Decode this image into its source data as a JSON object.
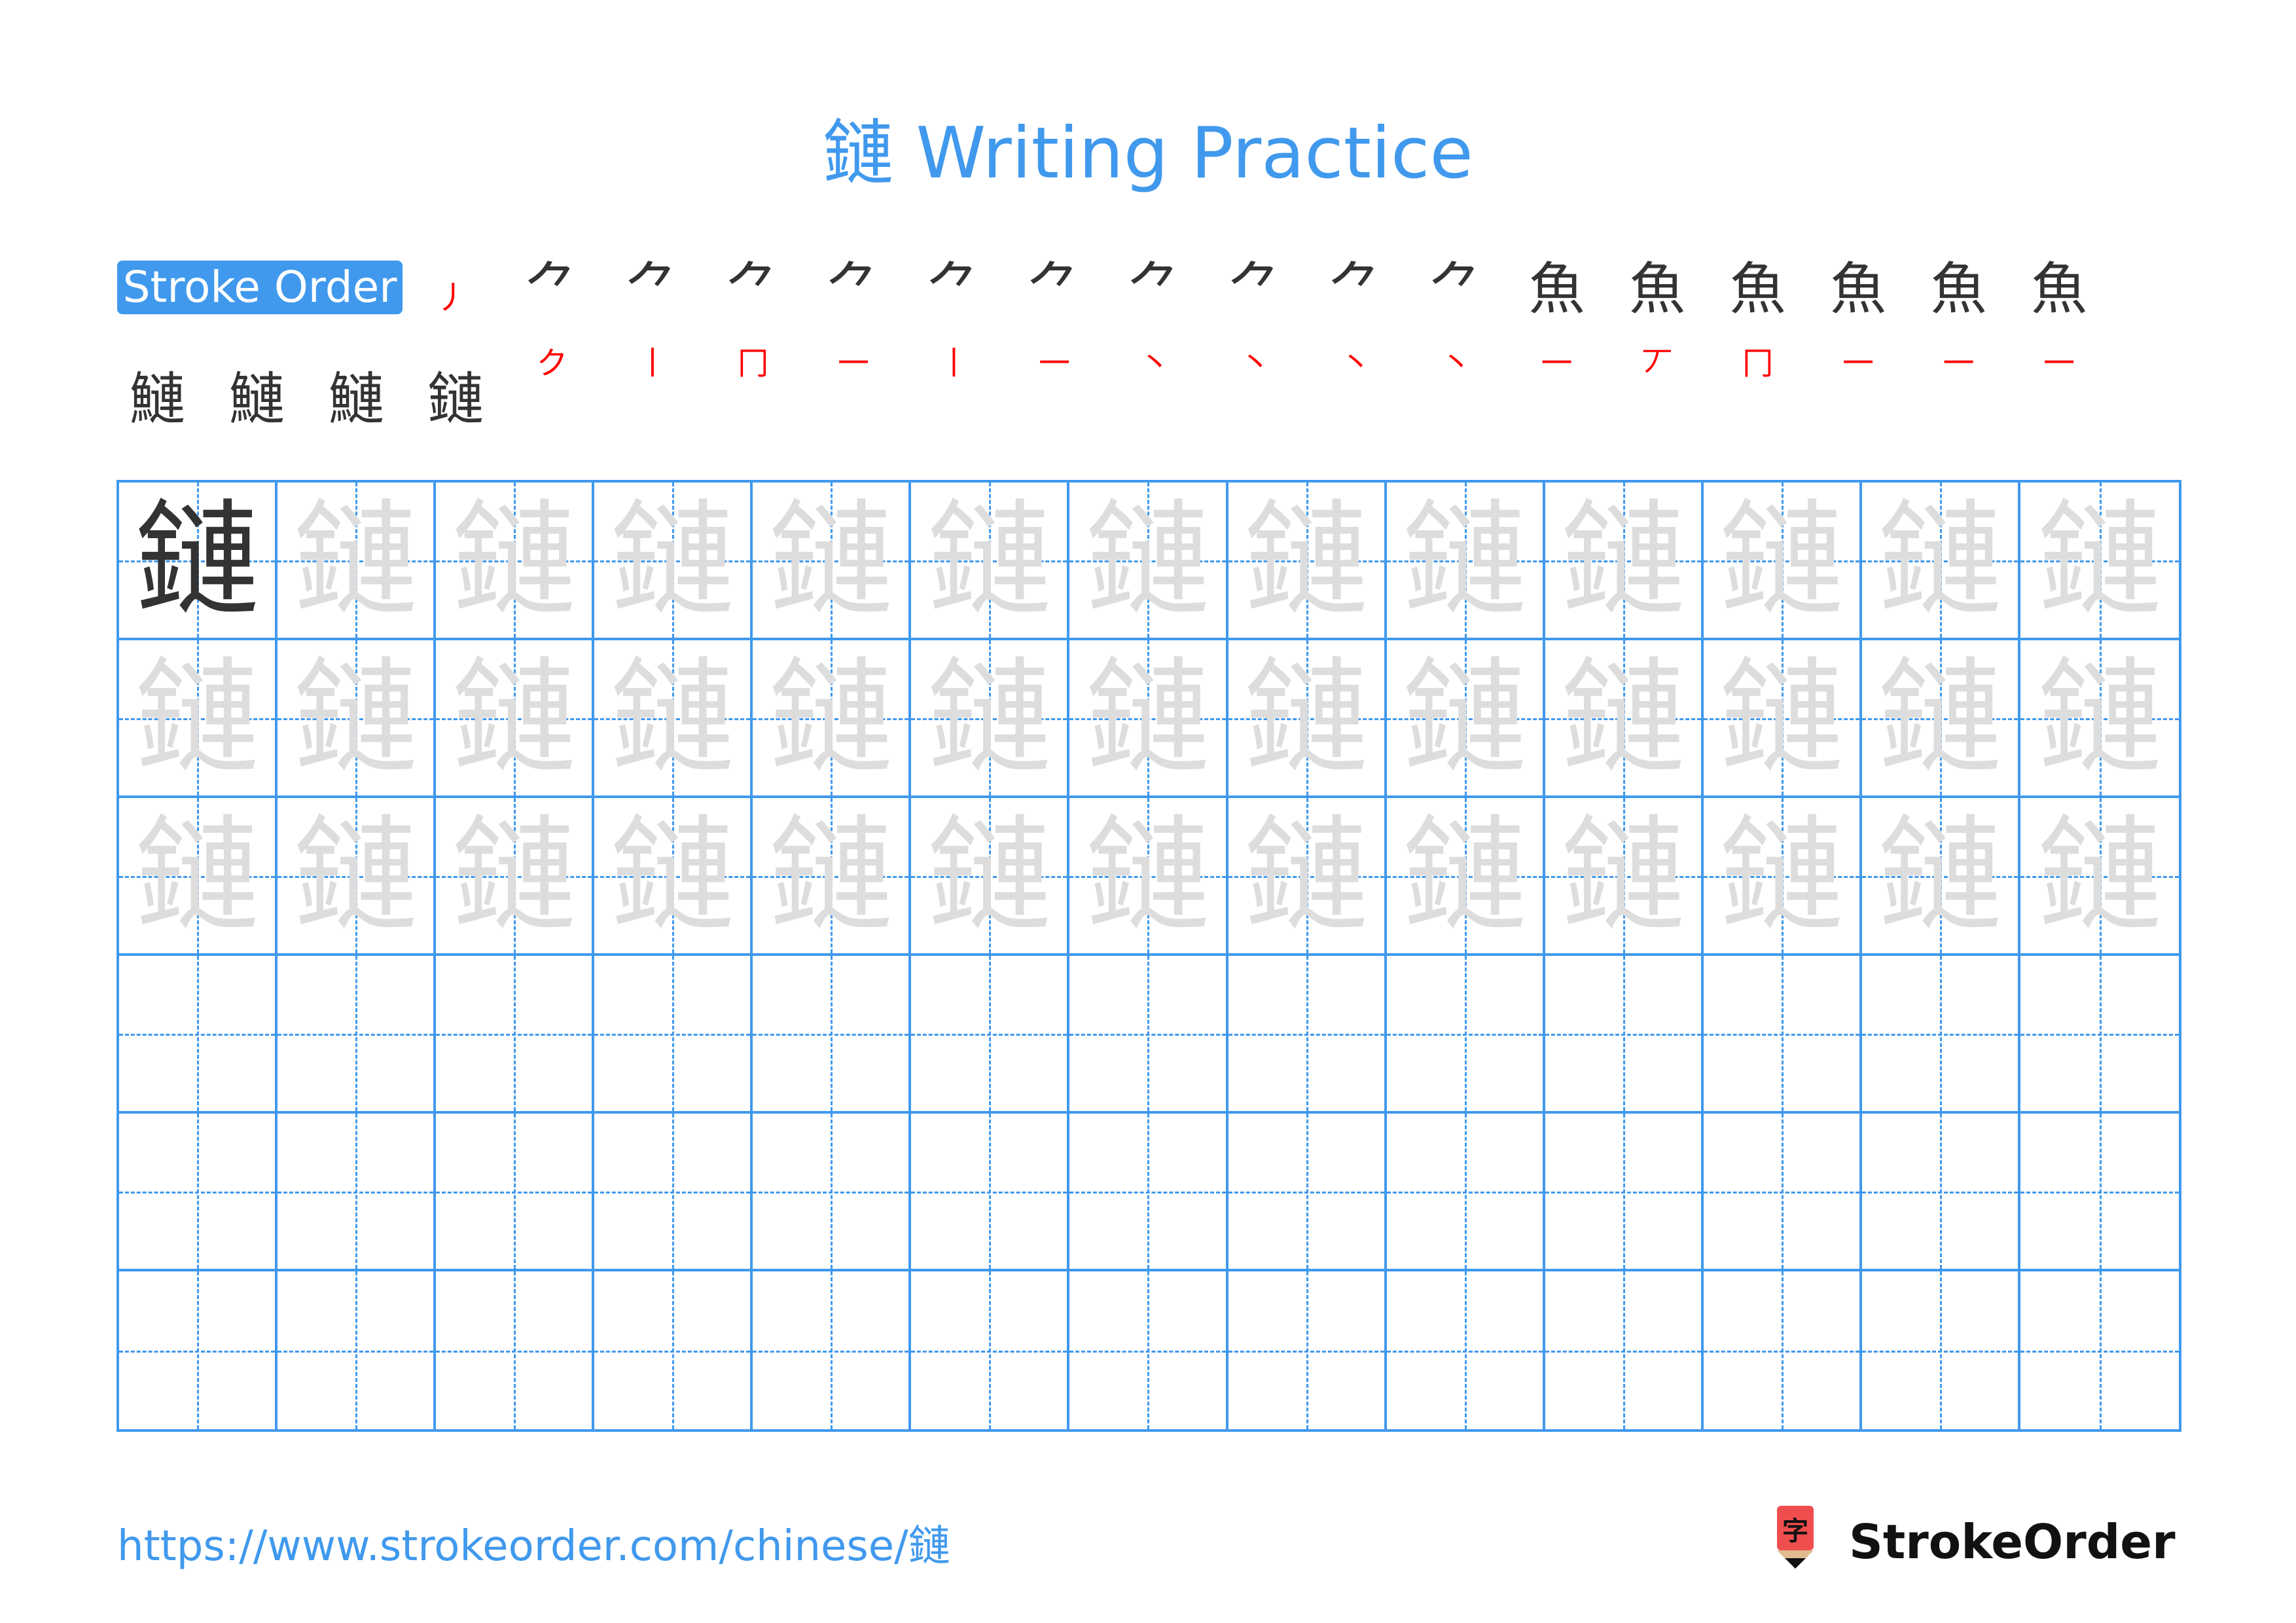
{
  "header": {
    "title": "鏈 Writing Practice"
  },
  "stroke_order": {
    "label": "Stroke Order",
    "character": "鏈",
    "total_strokes": 21,
    "steps": [
      {
        "step": 1,
        "drawn": "",
        "new": "丿"
      },
      {
        "step": 2,
        "drawn": "丿",
        "new": "𠃌"
      },
      {
        "step": 3,
        "drawn": "⺈",
        "new": "丨"
      },
      {
        "step": 4,
        "drawn": "⺈丨",
        "new": "𠃌"
      },
      {
        "step": 5,
        "drawn": "⺈冂",
        "new": "一"
      },
      {
        "step": 6,
        "drawn": "⺈冂一",
        "new": "丨"
      },
      {
        "step": 7,
        "drawn": "⺈田",
        "new": "一"
      },
      {
        "step": 8,
        "drawn": "⺈田一",
        "new": "丶"
      },
      {
        "step": 9,
        "drawn": "⺈田一丶",
        "new": "丶"
      },
      {
        "step": 10,
        "drawn": "魚(partial)",
        "new": "丶"
      },
      {
        "step": 11,
        "drawn": "魚(partial)",
        "new": "丶"
      },
      {
        "step": 12,
        "drawn": "魚",
        "new": "一"
      },
      {
        "step": 13,
        "drawn": "魚一",
        "new": "丨"
      },
      {
        "step": 14,
        "drawn": "魚丆",
        "new": "𠃍"
      },
      {
        "step": 15,
        "drawn": "魚冂",
        "new": "一"
      },
      {
        "step": 16,
        "drawn": "魚冂一",
        "new": "一"
      },
      {
        "step": 17,
        "drawn": "魚亘",
        "new": "一"
      },
      {
        "step": 18,
        "drawn": "魚亘",
        "new": "丨"
      },
      {
        "step": 19,
        "drawn": "魚車",
        "new": "丶"
      },
      {
        "step": 20,
        "drawn": "魚車丶",
        "new": "㇋"
      },
      {
        "step": 21,
        "drawn": "魚車辶",
        "new": "㇏"
      }
    ],
    "row1_glyphs": [
      "丿",
      "⺈",
      "⺈",
      "⺈",
      "⺈",
      "⺈",
      "⺈",
      "⺈",
      "⺈",
      "⺈",
      "⺈",
      "魚",
      "魚",
      "魚",
      "魚",
      "魚",
      "魚"
    ],
    "row1_red": [
      "丿",
      "ク",
      "丨",
      "冂",
      "一",
      "丨",
      "一",
      "丶",
      "丶",
      "丶",
      "丶",
      "一",
      "丆",
      "冂",
      "一",
      "一",
      "一"
    ],
    "row2_glyphs": [
      "鰱",
      "鰱",
      "鰱",
      "鏈"
    ]
  },
  "practice_grid": {
    "character": "鏈",
    "columns": 13,
    "rows": 6,
    "model_cells": 1,
    "trace_rows": 3,
    "empty_rows": 3,
    "guide_color": "#4099ed",
    "trace_color": "#dddddd",
    "model_color": "#333333"
  },
  "footer": {
    "url": "https://www.strokeorder.com/chinese/鏈",
    "brand": "StrokeOrder",
    "logo_glyph": "字"
  },
  "colors": {
    "accent": "#4099ed",
    "stroke_highlight": "#ff0000",
    "logo_red": "#f04e4e",
    "logo_tan": "#dfbb8f"
  }
}
